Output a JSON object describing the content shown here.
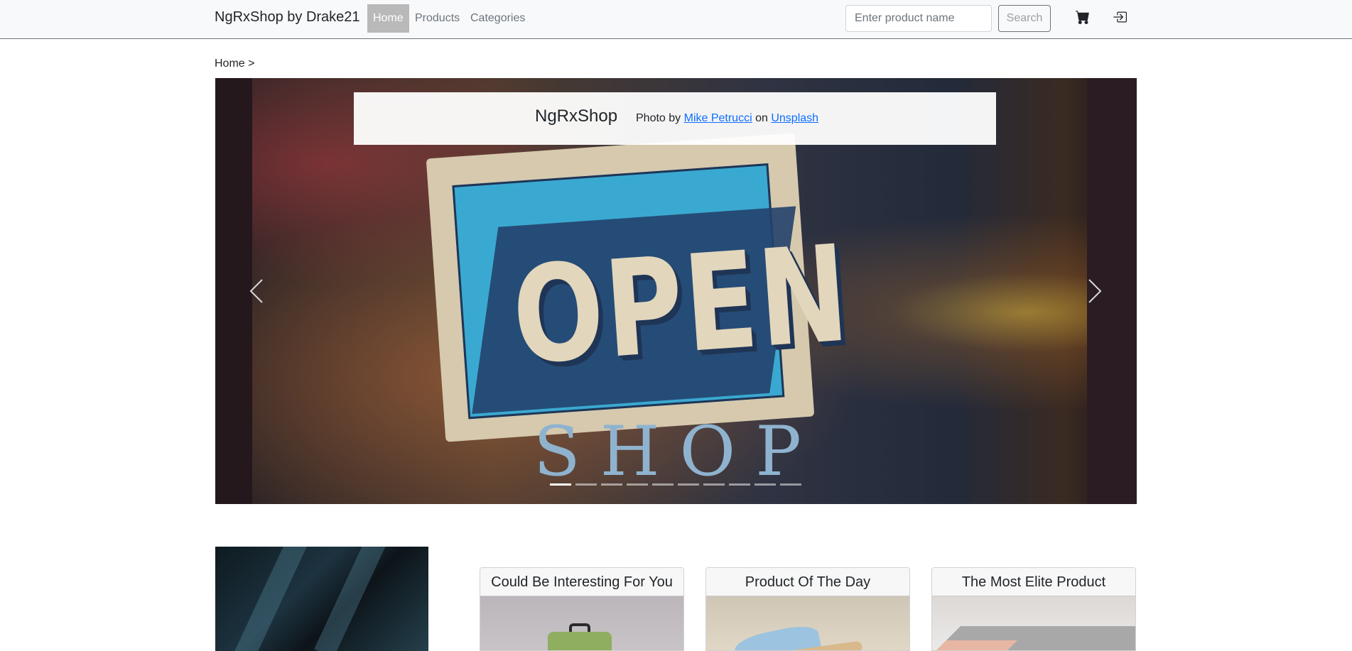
{
  "navbar": {
    "brand": "NgRxShop by Drake21",
    "links": [
      {
        "label": "Home",
        "active": true
      },
      {
        "label": "Products",
        "active": false
      },
      {
        "label": "Categories",
        "active": false
      }
    ],
    "search": {
      "placeholder": "Enter product name",
      "value": "",
      "button_label": "Search"
    },
    "icons": [
      "cart-icon",
      "sign-in-icon"
    ]
  },
  "breadcrumb": {
    "text": "Home >"
  },
  "carousel": {
    "caption": {
      "title": "NgRxShop",
      "credit_prefix": "Photo by",
      "author": "Mike Petrucci",
      "credit_middle": "on",
      "source": "Unsplash"
    },
    "slide_text": {
      "sign": "OPEN",
      "window": "SHOP"
    },
    "indicator_count": 10,
    "active_indicator": 0
  },
  "cards": [
    {
      "title": "Could Be Interesting For You"
    },
    {
      "title": "Product Of The Day"
    },
    {
      "title": "The Most Elite Product"
    }
  ],
  "colors": {
    "navbar_bg": "#f8f9fa",
    "active_nav_bg": "#b9b9b9",
    "link": "#0d6efd",
    "sign_blue": "#3aa9d1",
    "shop_text": "#8fb3cf"
  }
}
